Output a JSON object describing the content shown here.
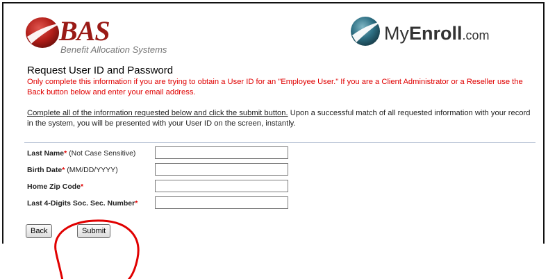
{
  "header": {
    "bas_logo_text": "BAS",
    "bas_logo_subtitle": "Benefit Allocation Systems",
    "myenroll_prefix": "My",
    "myenroll_bold": "Enroll",
    "myenroll_suffix": ".com"
  },
  "page": {
    "title": "Request User ID and Password",
    "red_note": "Only complete this information if you are trying to obtain a User ID for an \"Employee User.\" If you are a Client Administrator or a Reseller use the Back button below and enter your email address.",
    "instructions_underlined": "Complete all of the information requested below and click the submit button.",
    "instructions_rest": " Upon a successful match of all requested information with your record in the system, you will be presented with your User ID on the screen, instantly."
  },
  "form": {
    "fields": [
      {
        "label": "Last Name",
        "required_mark": "*",
        "hint": " (Not Case Sensitive)",
        "value": ""
      },
      {
        "label": "Birth Date",
        "required_mark": "*",
        "hint": " (MM/DD/YYYY)",
        "value": ""
      },
      {
        "label": "Home Zip Code",
        "required_mark": "*",
        "hint": "",
        "value": ""
      },
      {
        "label": "Last 4-Digits Soc. Sec. Number",
        "required_mark": "*",
        "hint": "",
        "value": ""
      }
    ],
    "back_label": "Back",
    "submit_label": "Submit"
  },
  "colors": {
    "note_red": "#e00000",
    "annotation_circle": "#e00000",
    "bas_red": "#9a1a16",
    "divider": "#b8c4d6"
  }
}
